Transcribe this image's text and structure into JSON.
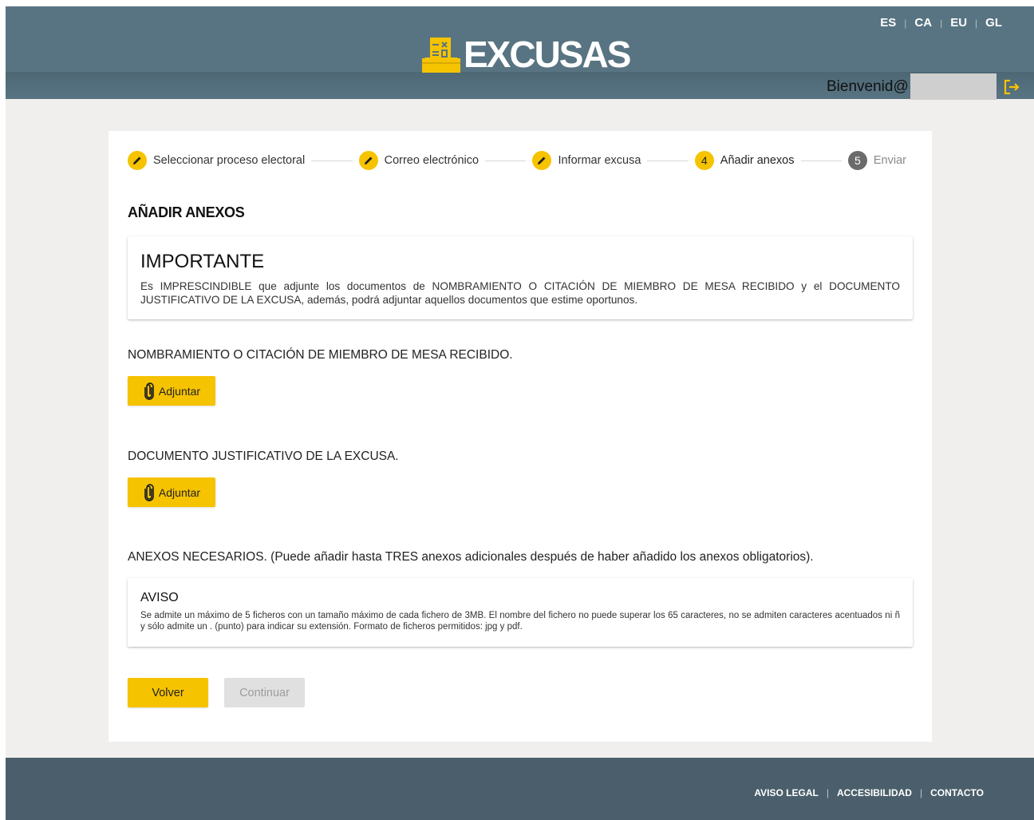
{
  "header": {
    "logo_text": "EXCUSAS",
    "languages": [
      "ES",
      "CA",
      "EU",
      "GL"
    ],
    "welcome": "Bienvenid@"
  },
  "stepper": {
    "steps": [
      {
        "label": "Seleccionar proceso electoral",
        "state": "done"
      },
      {
        "label": "Correo electrónico",
        "state": "done"
      },
      {
        "label": "Informar excusa",
        "state": "done"
      },
      {
        "number": "4",
        "label": "Añadir anexos",
        "state": "active"
      },
      {
        "number": "5",
        "label": "Enviar",
        "state": "pending"
      }
    ]
  },
  "main": {
    "title": "AÑADIR ANEXOS",
    "importante": {
      "heading": "IMPORTANTE",
      "text": "Es IMPRESCINDIBLE que adjunte los documentos de NOMBRAMIENTO O CITACIÓN DE MIEMBRO DE MESA RECIBIDO y el DOCUMENTO JUSTIFICATIVO DE LA EXCUSA, además, podrá adjuntar aquellos documentos que estime oportunos."
    },
    "field1_label": "NOMBRAMIENTO O CITACIÓN DE MIEMBRO DE MESA RECIBIDO.",
    "field2_label": "DOCUMENTO JUSTIFICATIVO DE LA EXCUSA.",
    "attach_label": "Adjuntar",
    "anexos_label": "ANEXOS NECESARIOS. (Puede añadir hasta TRES anexos adicionales después de haber añadido los anexos obligatorios).",
    "aviso": {
      "heading": "AVISO",
      "text": "Se admite un máximo de 5 ficheros con un tamaño máximo de cada fichero de 3MB. El nombre del fichero no puede superar los 65 caracteres, no se admiten caracteres acentuados ni ñ y sólo admite un . (punto) para indicar su extensión. Formato de ficheros permitidos: jpg y pdf."
    },
    "back_label": "Volver",
    "continue_label": "Continuar"
  },
  "footer": {
    "links": [
      "AVISO LEGAL",
      "ACCESIBILIDAD",
      "CONTACTO"
    ]
  },
  "colors": {
    "header": "#587482",
    "accent": "#f6c300",
    "footer": "#4a5f6b",
    "background": "#f1efed"
  },
  "icons": {
    "edit": "pencil-icon",
    "attach": "paperclip-icon",
    "logout": "logout-icon",
    "logo": "ballot-box-icon"
  }
}
